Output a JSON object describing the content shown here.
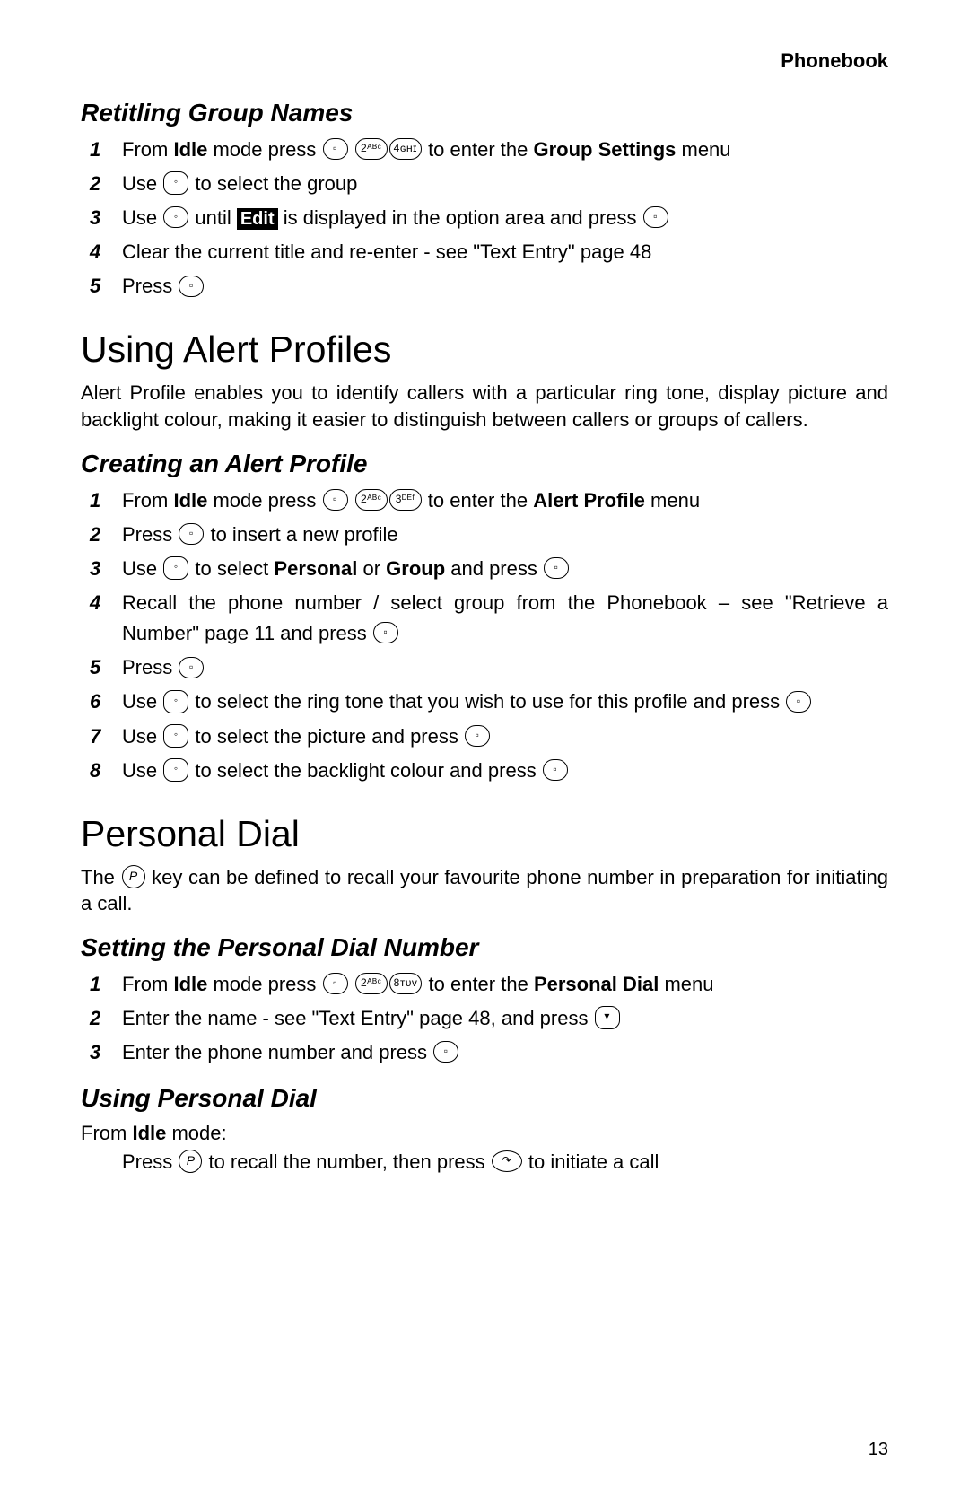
{
  "header": {
    "section": "Phonebook"
  },
  "retitling": {
    "title": "Retitling Group Names",
    "steps": {
      "s1a": "From ",
      "s1b": "Idle",
      "s1c": " mode press ",
      "s1d": " to enter the ",
      "s1e": "Group Settings",
      "s1f": " menu",
      "s2a": "Use ",
      "s2b": " to select the group",
      "s3a": "Use ",
      "s3b": " until ",
      "s3edit": "Edit",
      "s3c": " is displayed in the option area and press ",
      "s4": "Clear the current title and re-enter - see \"Text Entry\" page 48",
      "s5a": "Press "
    }
  },
  "alert": {
    "title": "Using Alert Profiles",
    "intro": "Alert Profile enables you to identify callers with a particular ring tone, display picture and backlight colour, making it easier to distinguish between callers or groups of callers.",
    "sub": "Creating an Alert Profile",
    "steps": {
      "s1a": "From ",
      "s1b": "Idle",
      "s1c": " mode press ",
      "s1d": " to enter the ",
      "s1e": "Alert Profile",
      "s1f": " menu",
      "s2a": "Press ",
      "s2b": " to insert a new profile",
      "s3a": "Use ",
      "s3b": " to select ",
      "s3c": "Personal",
      "s3d": " or ",
      "s3e": "Group",
      "s3f": " and press ",
      "s4a": "Recall the phone number / select group from the Phonebook – see \"Retrieve a Number\" page 11 and press ",
      "s5a": "Press ",
      "s6a": "Use ",
      "s6b": " to select the ring tone that you wish to use for this profile and press ",
      "s7a": "Use ",
      "s7b": " to select the picture and press ",
      "s8a": "Use ",
      "s8b": " to select the backlight colour and press "
    }
  },
  "personal": {
    "title": "Personal Dial",
    "intro1": "The ",
    "intro2": " key can be defined to recall your favourite phone number in preparation for initiating a call.",
    "sub1": "Setting the Personal Dial Number",
    "steps": {
      "s1a": "From ",
      "s1b": "Idle",
      "s1c": " mode press ",
      "s1d": " to enter the ",
      "s1e": "Personal Dial",
      "s1f": " menu",
      "s2a": "Enter the name - see \"Text Entry\" page 48, and press ",
      "s3a": "Enter the phone number and press "
    },
    "sub2": "Using Personal Dial",
    "idle_a": "From ",
    "idle_b": "Idle",
    "idle_c": " mode:",
    "use_a": "Press ",
    "use_b": " to recall the number, then press ",
    "use_c": " to initiate a call"
  },
  "icons": {
    "soft": "▫",
    "nav": "◦",
    "key2": "2ᴬᴮᶜ",
    "key3": "3ᴰᴱᶠ",
    "key4": "4ɢʜɪ",
    "key8": "8ᴛᴜᴠ",
    "ok": "▫",
    "p": "P",
    "call": "↷",
    "down": "▾"
  },
  "page": "13"
}
